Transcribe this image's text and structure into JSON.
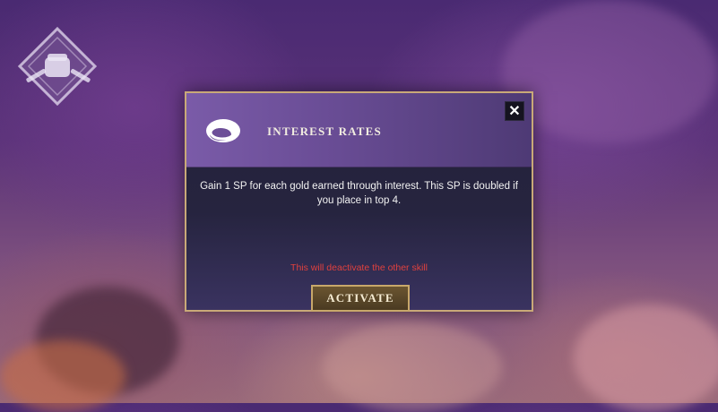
{
  "logo": {
    "icon": "fist-wrench-emblem-icon"
  },
  "modal": {
    "title": "INTEREST RATES",
    "icon": "gold-coin-icon",
    "close_glyph": "✕",
    "description": "Gain 1 SP for each gold earned through interest. This SP is doubled if you place in top 4.",
    "warning": "This will deactivate the other skill",
    "activate_label": "ACTIVATE"
  },
  "colors": {
    "border_gold": "#c9a978",
    "header_purple": "#7a5ba8",
    "warning_red": "#e0413e",
    "button_gold": "#c8a86a"
  }
}
